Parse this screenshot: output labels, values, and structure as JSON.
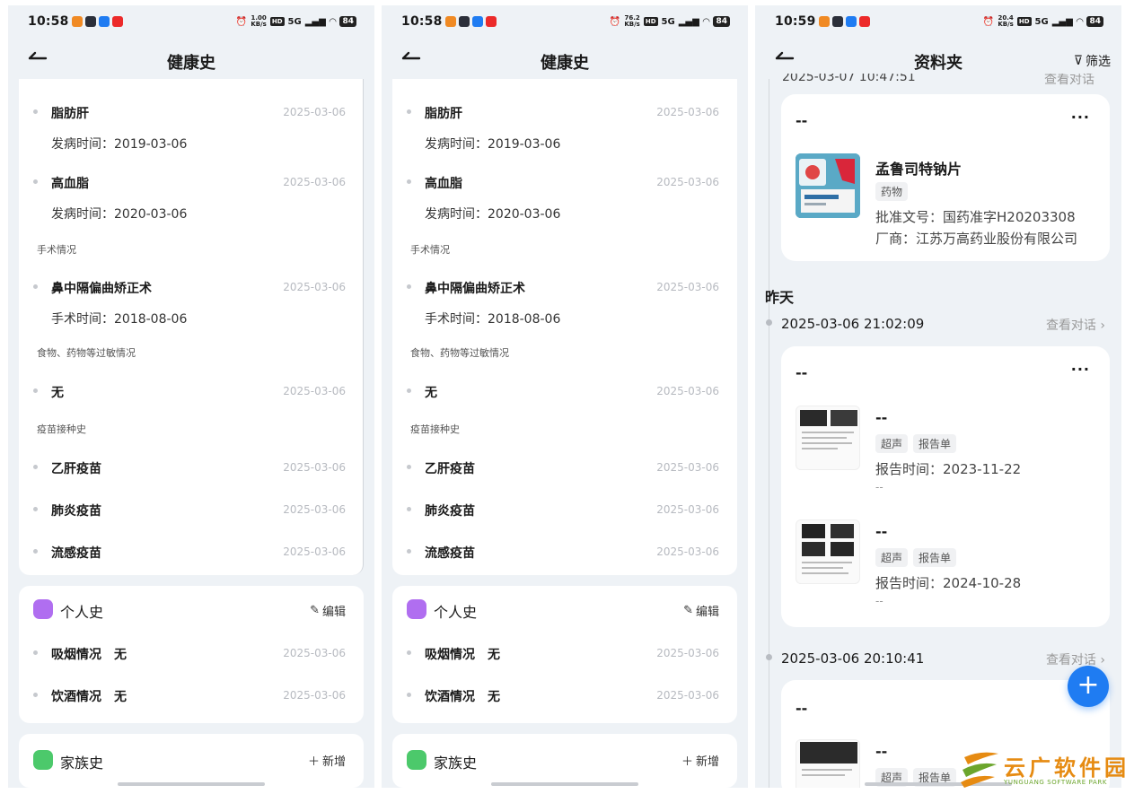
{
  "status_bars": [
    {
      "time": "10:58",
      "speed_value": "1.00",
      "speed_unit": "KB/s",
      "hd": "HD",
      "network": "5G",
      "battery": "84"
    },
    {
      "time": "10:58",
      "speed_value": "76.2",
      "speed_unit": "KB/s",
      "hd": "HD",
      "network": "5G",
      "battery": "84"
    },
    {
      "time": "10:59",
      "speed_value": "20.4",
      "speed_unit": "KB/s",
      "hd": "HD",
      "network": "5G",
      "battery": "84"
    }
  ],
  "health": {
    "title": "健康史",
    "diseases": [
      {
        "name": "脂肪肝",
        "date": "2025-03-06",
        "detail": "发病时间：2019-03-06"
      },
      {
        "name": "高血脂",
        "date": "2025-03-06",
        "detail": "发病时间：2020-03-06"
      }
    ],
    "surgery_label": "手术情况",
    "surgeries": [
      {
        "name": "鼻中隔偏曲矫正术",
        "date": "2025-03-06",
        "detail": "手术时间：2018-08-06"
      }
    ],
    "allergy_label": "食物、药物等过敏情况",
    "allergy": {
      "name": "无",
      "date": "2025-03-06"
    },
    "vaccine_label": "疫苗接种史",
    "vaccines": [
      {
        "name": "乙肝疫苗",
        "date": "2025-03-06"
      },
      {
        "name": "肺炎疫苗",
        "date": "2025-03-06"
      },
      {
        "name": "流感疫苗",
        "date": "2025-03-06"
      }
    ],
    "personal": {
      "title": "个人史",
      "action": "编辑",
      "items": [
        {
          "name": "吸烟情况",
          "value": "无",
          "date": "2025-03-06"
        },
        {
          "name": "饮酒情况",
          "value": "无",
          "date": "2025-03-06"
        }
      ]
    },
    "family": {
      "title": "家族史",
      "action": "新增"
    }
  },
  "folder": {
    "title": "资料夹",
    "filter": "筛选",
    "peek_text": "2025-03-07 10:47:51",
    "peek_link": "查看对话",
    "card1": {
      "title": "--",
      "more": "···",
      "drug_name": "孟鲁司特钠片",
      "tag": "药物",
      "approval": "批准文号：国药准字H20203308",
      "maker": "厂商：江苏万高药业股份有限公司"
    },
    "day_label": "昨天",
    "entry1": {
      "time": "2025-03-06 21:02:09",
      "link": "查看对话"
    },
    "card2": {
      "title": "--",
      "more": "···",
      "reports": [
        {
          "name": "--",
          "tags": [
            "超声",
            "报告单"
          ],
          "time": "报告时间：2023-11-22",
          "note": "--"
        },
        {
          "name": "--",
          "tags": [
            "超声",
            "报告单"
          ],
          "time": "报告时间：2024-10-28",
          "note": "--"
        }
      ]
    },
    "entry2": {
      "time": "2025-03-06 20:10:41",
      "link": "查看对话"
    },
    "card3": {
      "title": "--",
      "report_name": "--",
      "tags": [
        "超声",
        "报告单"
      ]
    },
    "fab": "+"
  },
  "watermark": {
    "main": "云广软件园",
    "sub": "YUNGUANG SOFTWARE PARK"
  }
}
